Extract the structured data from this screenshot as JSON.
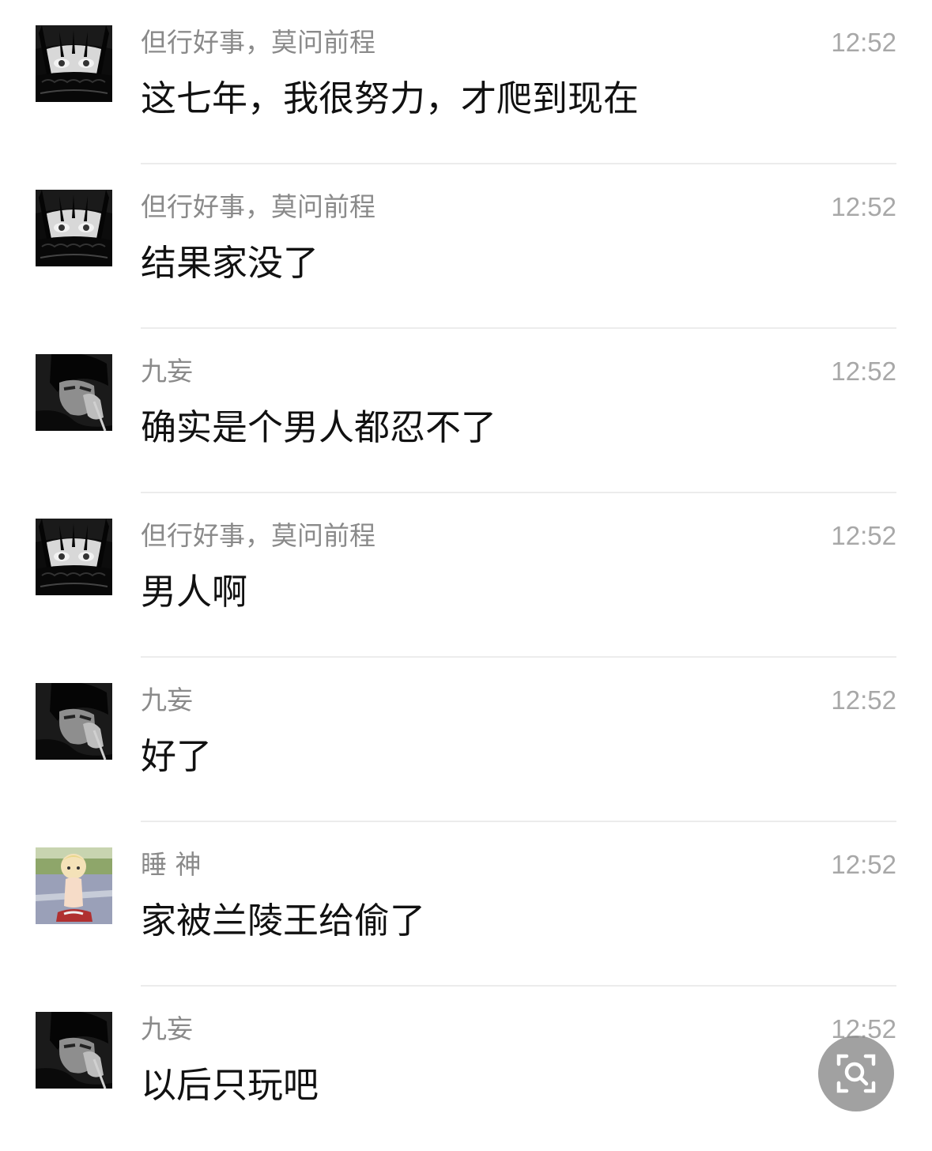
{
  "messages": [
    {
      "sender": "但行好事，莫问前程",
      "time": "12:52",
      "text": "这七年，我很努力，才爬到现在",
      "avatar": "goth-girl-avatar"
    },
    {
      "sender": "但行好事，莫问前程",
      "time": "12:52",
      "text": "结果家没了",
      "avatar": "goth-girl-avatar"
    },
    {
      "sender": "九妄",
      "time": "12:52",
      "text": "确实是个男人都忍不了",
      "avatar": "dark-man-avatar"
    },
    {
      "sender": "但行好事，莫问前程",
      "time": "12:52",
      "text": "男人啊",
      "avatar": "goth-girl-avatar"
    },
    {
      "sender": "九妄",
      "time": "12:52",
      "text": "好了",
      "avatar": "dark-man-avatar"
    },
    {
      "sender": "睡 神",
      "time": "12:52",
      "text": "家被兰陵王给偷了",
      "avatar": "anime-baby-avatar"
    },
    {
      "sender": "九妄",
      "time": "12:52",
      "text": "以后只玩吧",
      "avatar": "dark-man-avatar"
    }
  ],
  "floating_button": {
    "icon": "image-search-icon"
  },
  "colors": {
    "name_text": "#8a8a8a",
    "time_text": "#a8a8a8",
    "message_text": "#111111",
    "divider": "#ececec",
    "fab_bg": "#8c8c8c"
  }
}
